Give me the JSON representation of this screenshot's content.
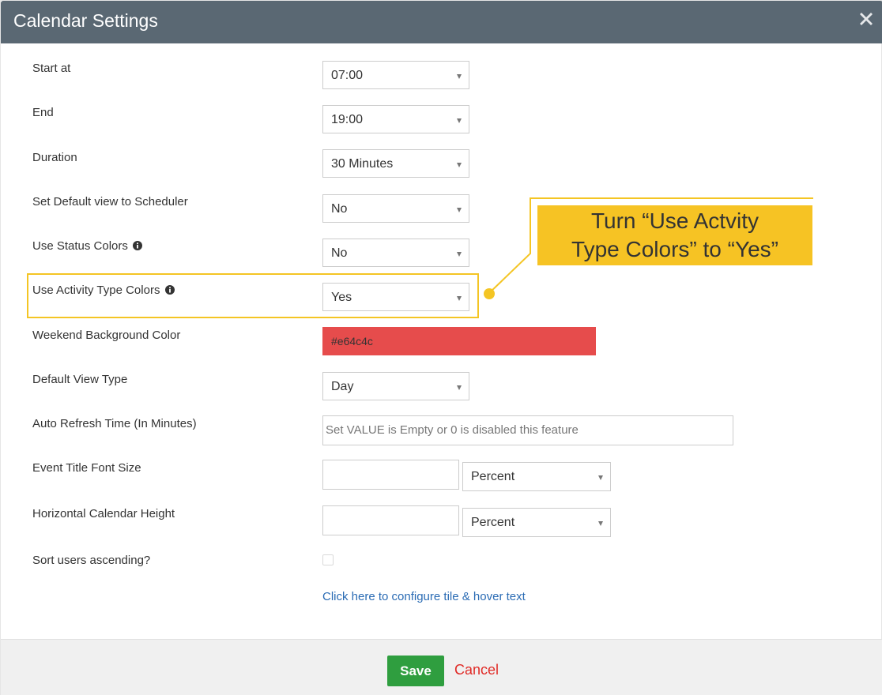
{
  "dialog": {
    "title": "Calendar Settings",
    "close_icon": "close-x-icon"
  },
  "fields": {
    "start_at": {
      "label": "Start at",
      "value": "07:00"
    },
    "end": {
      "label": "End",
      "value": "19:00"
    },
    "duration": {
      "label": "Duration",
      "value": "30 Minutes"
    },
    "default_view_scheduler": {
      "label": "Set Default view to Scheduler",
      "value": "No"
    },
    "use_status_colors": {
      "label": "Use Status Colors",
      "value": "No",
      "icon": "info-circle-icon"
    },
    "use_activity_type_colors": {
      "label": "Use Activity Type Colors",
      "value": "Yes",
      "icon": "info-circle-icon"
    },
    "weekend_bg_color": {
      "label": "Weekend Background Color",
      "value": "#e64c4c",
      "color": "#e64c4c"
    },
    "default_view_type": {
      "label": "Default View Type",
      "value": "Day"
    },
    "auto_refresh": {
      "label": "Auto Refresh Time (In Minutes)",
      "placeholder": "Set VALUE is Empty or 0 is disabled this feature"
    },
    "event_title_font_size": {
      "label": "Event Title Font Size",
      "value": "",
      "unit": "Percent"
    },
    "horizontal_calendar_height": {
      "label": "Horizontal Calendar Height",
      "value": "",
      "unit": "Percent"
    },
    "sort_users_ascending": {
      "label": "Sort users ascending?",
      "checked": false
    }
  },
  "configure_link": "Click here to configure tile & hover text",
  "annotation": {
    "line1": "Turn “Use Actvity",
    "line2": "Type Colors” to “Yes”",
    "color": "#f6c324"
  },
  "footer": {
    "save_label": "Save",
    "cancel_label": "Cancel"
  },
  "colors": {
    "header_bg": "#5a6873",
    "save_bg": "#2f9e3f",
    "cancel_text": "#e02b27",
    "link_text": "#2a6bb4"
  }
}
